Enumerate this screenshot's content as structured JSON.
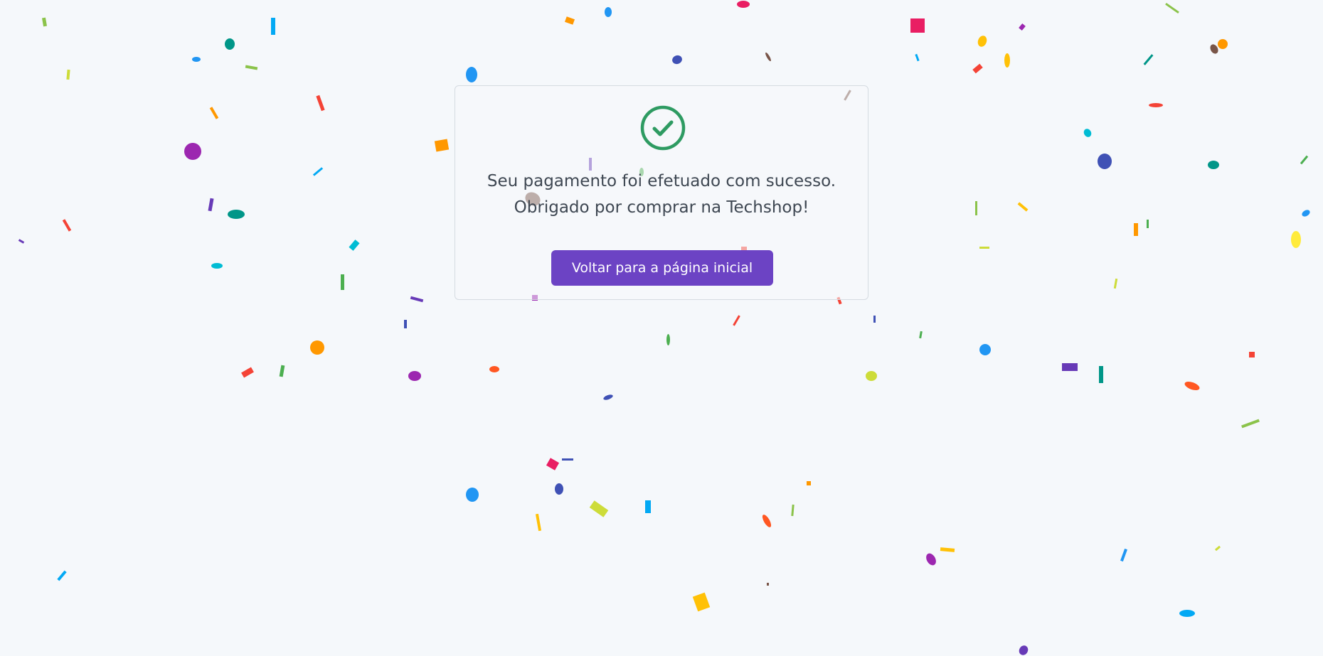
{
  "success": {
    "icon": "check-circle-icon",
    "line1": "Seu pagamento foi efetuado com sucesso.",
    "line2": "Obrigado por comprar na Techshop!",
    "button_label": "Voltar para a página inicial"
  },
  "confetti": {
    "icon": "confetti",
    "colors": [
      "#e91e63",
      "#9c27b0",
      "#673ab7",
      "#3f51b5",
      "#2196f3",
      "#03a9f4",
      "#00bcd4",
      "#009688",
      "#4caf50",
      "#8bc34a",
      "#cddc39",
      "#ffeb3b",
      "#ffc107",
      "#ff9800",
      "#ff5722",
      "#f44336",
      "#795548"
    ]
  },
  "colors": {
    "background": "#f5f8fb",
    "accent": "#6c43c4",
    "success": "#2e9b62",
    "text": "#3e4752",
    "card_border": "#d5dbe1"
  }
}
